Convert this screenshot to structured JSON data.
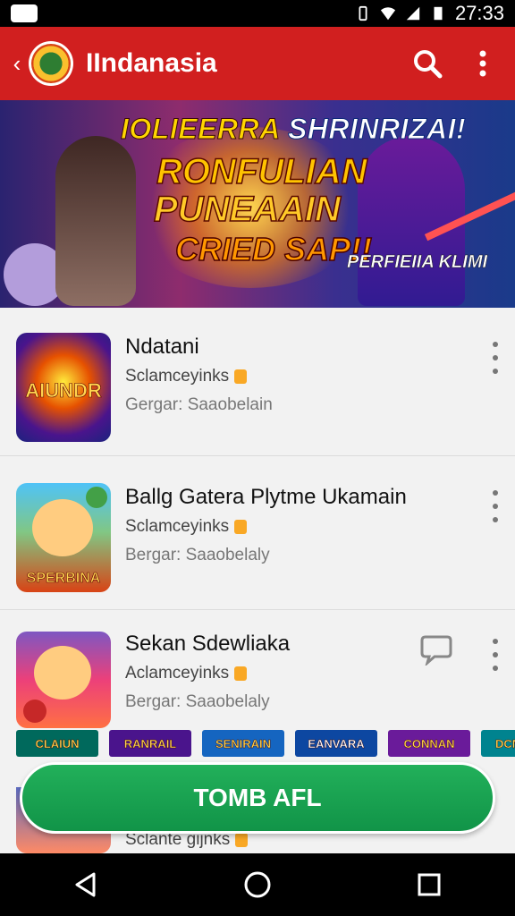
{
  "status_bar": {
    "time": "27:33"
  },
  "app_bar": {
    "back_icon": "back-arrow-icon",
    "title": "IIndanasia",
    "search_icon": "search-icon",
    "more_icon": "more-vert-icon"
  },
  "banner": {
    "line1_yellow": "IOLIEERRA",
    "line1_white": "SHRINRIZAI!",
    "line2": "RONFULIAN",
    "line3": "PUNEAAIN",
    "line4": "CRIED SAP!!",
    "line5": "PERFIEIIA KLIMI"
  },
  "items": [
    {
      "name": "Ndatani",
      "subtitle": "Sclamceyinks",
      "meta": "Gergar: Saaobelain",
      "thumb_label": "AIUNDR"
    },
    {
      "name": "Ballg Gatera Plytme Ukamain",
      "subtitle": "Sclamceyinks",
      "meta": "Bergar: Saaobelaly",
      "thumb_label": "SPERBINA"
    },
    {
      "name": "Sekan Sdewliaka",
      "subtitle": "Aclamceyinks",
      "meta": "Bergar: Saaobelaly",
      "thumb_label": ""
    }
  ],
  "strip_tiles": [
    "CLAIUN",
    "RANRAIL",
    "SENIRAIN",
    "EANVARA",
    "CONNAN",
    "DCMRIAL"
  ],
  "ghost_item": {
    "subtitle": "Sclante gijnks"
  },
  "cta": {
    "label": "TOMB AFL"
  },
  "colors": {
    "app_bar": "#d11f1f",
    "cta": "#1aa251",
    "background": "#f2f2f2"
  }
}
